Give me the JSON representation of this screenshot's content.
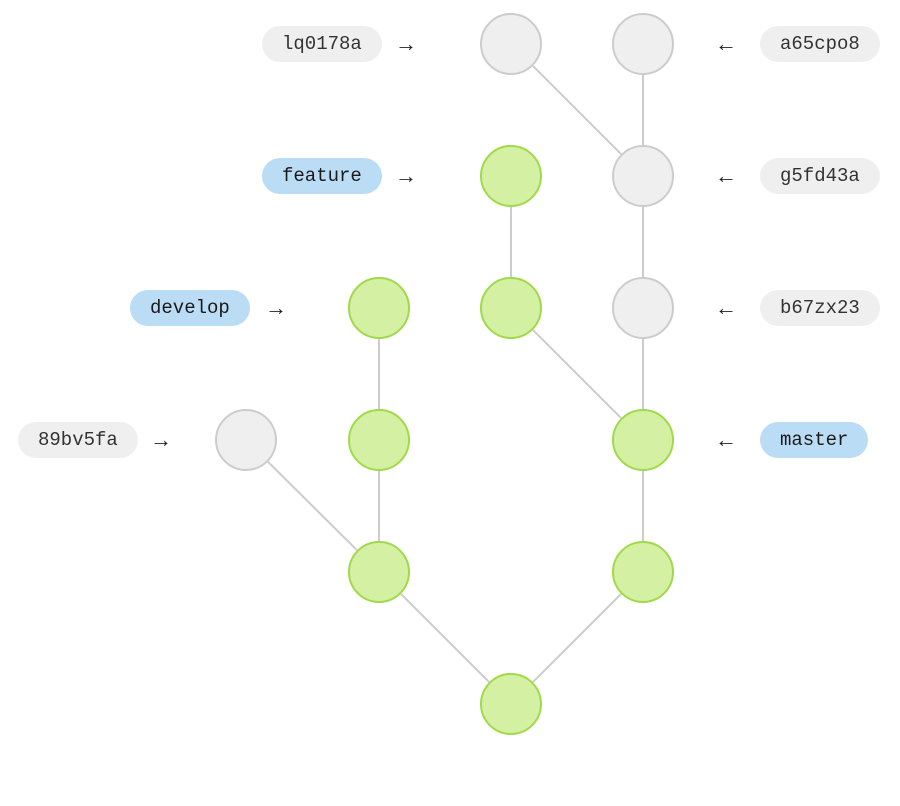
{
  "diagram": {
    "labels": {
      "row1_left": "lq0178a",
      "row1_right": "a65cpo8",
      "row2_left": "feature",
      "row2_right": "g5fd43a",
      "row3_left": "develop",
      "row3_right": "b67zx23",
      "row4_left": "89bv5fa",
      "row4_right": "master"
    },
    "arrows": {
      "right": "→",
      "left": "←"
    },
    "rows": {
      "r1": 44,
      "r2": 176,
      "r3": 308,
      "r4": 440,
      "r5": 572,
      "r6": 704,
      "r7": 770
    },
    "cols": {
      "c1": 246,
      "c2": 379,
      "c3": 511,
      "c4": 643
    },
    "nodes": [
      {
        "id": "n1",
        "row": "r1",
        "col": "c3",
        "type": "gray"
      },
      {
        "id": "n2",
        "row": "r1",
        "col": "c4",
        "type": "gray"
      },
      {
        "id": "n3",
        "row": "r2",
        "col": "c3",
        "type": "green"
      },
      {
        "id": "n4",
        "row": "r2",
        "col": "c4",
        "type": "gray"
      },
      {
        "id": "n5",
        "row": "r3",
        "col": "c2",
        "type": "green"
      },
      {
        "id": "n6",
        "row": "r3",
        "col": "c3",
        "type": "green"
      },
      {
        "id": "n7",
        "row": "r3",
        "col": "c4",
        "type": "gray"
      },
      {
        "id": "n8",
        "row": "r4",
        "col": "c1",
        "type": "gray"
      },
      {
        "id": "n9",
        "row": "r4",
        "col": "c2",
        "type": "green"
      },
      {
        "id": "n10",
        "row": "r4",
        "col": "c4",
        "type": "green"
      },
      {
        "id": "n11",
        "row": "r5",
        "col": "c2",
        "type": "green"
      },
      {
        "id": "n12",
        "row": "r5",
        "col": "c4",
        "type": "green"
      },
      {
        "id": "n13",
        "row": "r6",
        "col": "c3",
        "type": "green"
      }
    ],
    "edges": [
      {
        "from": "n1",
        "to": "n4"
      },
      {
        "from": "n2",
        "to": "n4"
      },
      {
        "from": "n3",
        "to": "n6"
      },
      {
        "from": "n4",
        "to": "n7"
      },
      {
        "from": "n5",
        "to": "n9"
      },
      {
        "from": "n6",
        "to": "n10"
      },
      {
        "from": "n7",
        "to": "n10"
      },
      {
        "from": "n8",
        "to": "n11"
      },
      {
        "from": "n9",
        "to": "n11"
      },
      {
        "from": "n10",
        "to": "n12"
      },
      {
        "from": "n11",
        "to": "n13"
      },
      {
        "from": "n12",
        "to": "n13"
      }
    ]
  }
}
